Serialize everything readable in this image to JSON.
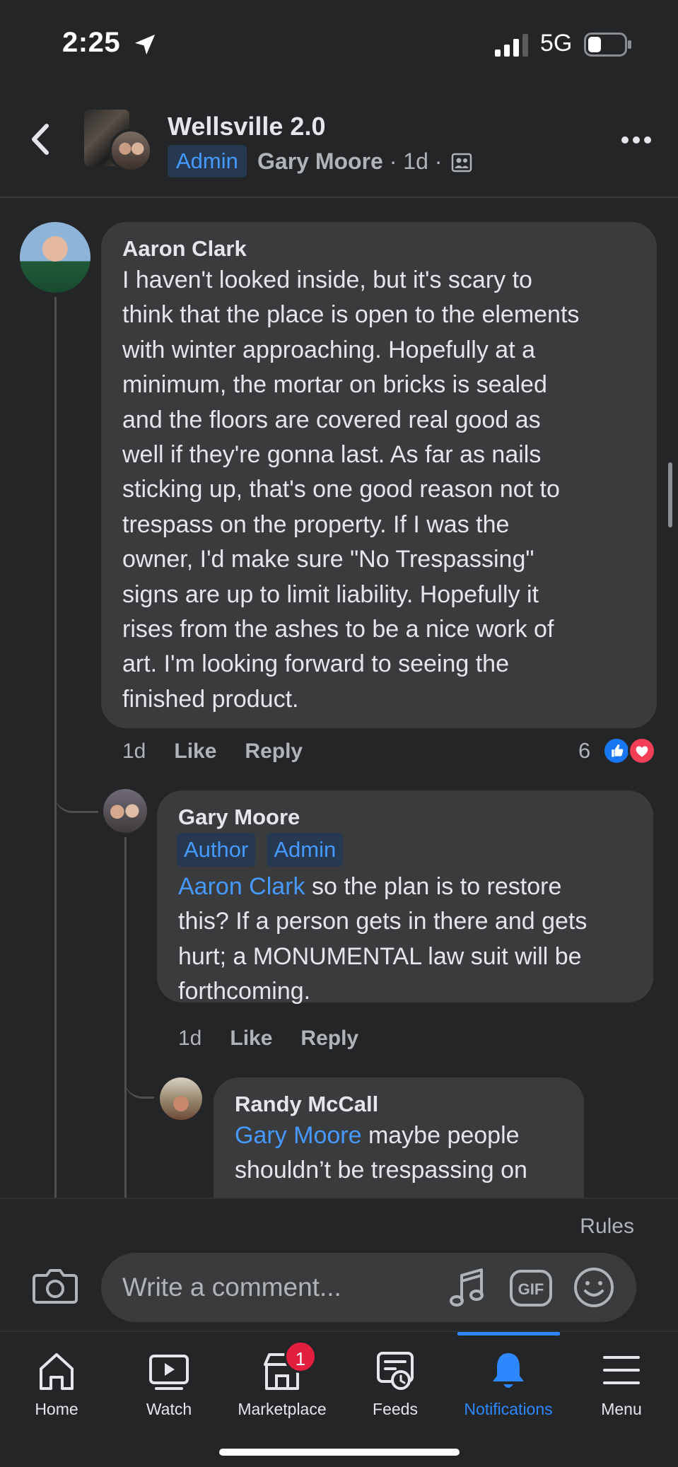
{
  "status": {
    "time": "2:25",
    "network": "5G"
  },
  "header": {
    "title": "Wellsville 2.0",
    "role_badge": "Admin",
    "poster": "Gary Moore",
    "age": "1d"
  },
  "comments": [
    {
      "author": "Aaron Clark",
      "text": "I haven't looked inside, but it's scary to\nthink that the place is open to the elements\nwith winter approaching.  Hopefully at a\nminimum, the mortar on bricks is sealed\nand the floors are covered real good as\nwell if they're gonna last.  As far as nails\nsticking up, that's one good reason not to\ntrespass on the property.  If I was the\nowner, I'd make sure \"No Trespassing\"\nsigns are up to limit liability.  Hopefully it\nrises from the ashes to be a nice work of\nart.  I'm looking forward to seeing the\nfinished product.",
      "time": "1d",
      "like": "Like",
      "reply": "Reply",
      "reaction_count": "6",
      "reactions": [
        "like",
        "love"
      ]
    },
    {
      "author": "Gary Moore",
      "badges": [
        "Author",
        "Admin"
      ],
      "mention": "Aaron Clark",
      "text": " so the plan is to restore\nthis? If a person gets in there and gets\nhurt; a MONUMENTAL law suit will be\nforthcoming.",
      "time": "1d",
      "like": "Like",
      "reply": "Reply"
    },
    {
      "author": "Randy McCall",
      "mention": "Gary Moore",
      "text": " maybe people\nshouldn’t be trespassing on"
    }
  ],
  "composer": {
    "rules": "Rules",
    "placeholder": "Write a comment..."
  },
  "tabs": [
    {
      "label": "Home",
      "icon": "home-icon"
    },
    {
      "label": "Watch",
      "icon": "watch-icon"
    },
    {
      "label": "Marketplace",
      "icon": "marketplace-icon",
      "badge": "1"
    },
    {
      "label": "Feeds",
      "icon": "feeds-icon"
    },
    {
      "label": "Notifications",
      "icon": "bell-icon",
      "active": true
    },
    {
      "label": "Menu",
      "icon": "menu-icon"
    }
  ],
  "colors": {
    "accent": "#2d88ff",
    "link": "#4599ff",
    "bubble": "#3a3b3c",
    "background": "#242526"
  }
}
